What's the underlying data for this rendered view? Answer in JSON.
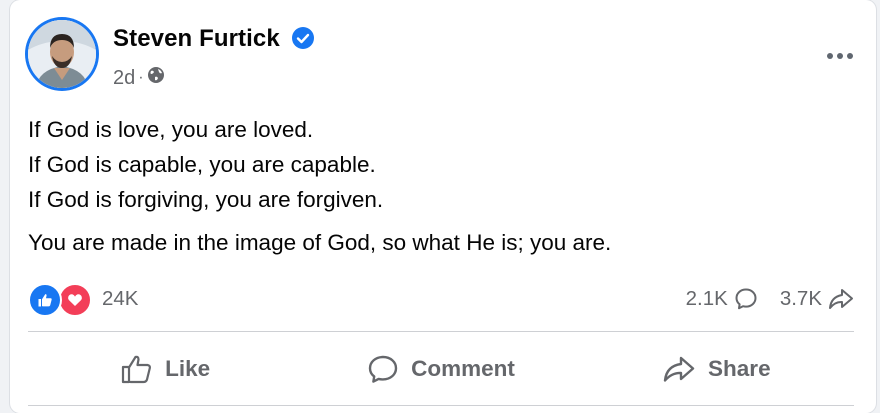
{
  "post": {
    "author": {
      "name": "Steven Furtick",
      "verified": true,
      "avatar_icon": "profile-photo"
    },
    "timestamp": "2d",
    "separator": "·",
    "audience_icon": "globe-icon",
    "more_icon": "more-options-icon",
    "text": {
      "lines": [
        "If God is love, you are loved.",
        "If God is capable, you are capable.",
        "If God is forgiving, you are forgiven."
      ],
      "paragraph2": "You are made in the image of God, so what He is; you are."
    },
    "reactions": {
      "types": [
        "like",
        "love"
      ],
      "count": "24K"
    },
    "stats": {
      "comments": "2.1K",
      "shares": "3.7K"
    },
    "actions": {
      "like": "Like",
      "comment": "Comment",
      "share": "Share"
    }
  },
  "colors": {
    "accent": "#1877f2",
    "love": "#f33e58",
    "secondary_text": "#65676b",
    "primary_text": "#050505"
  }
}
